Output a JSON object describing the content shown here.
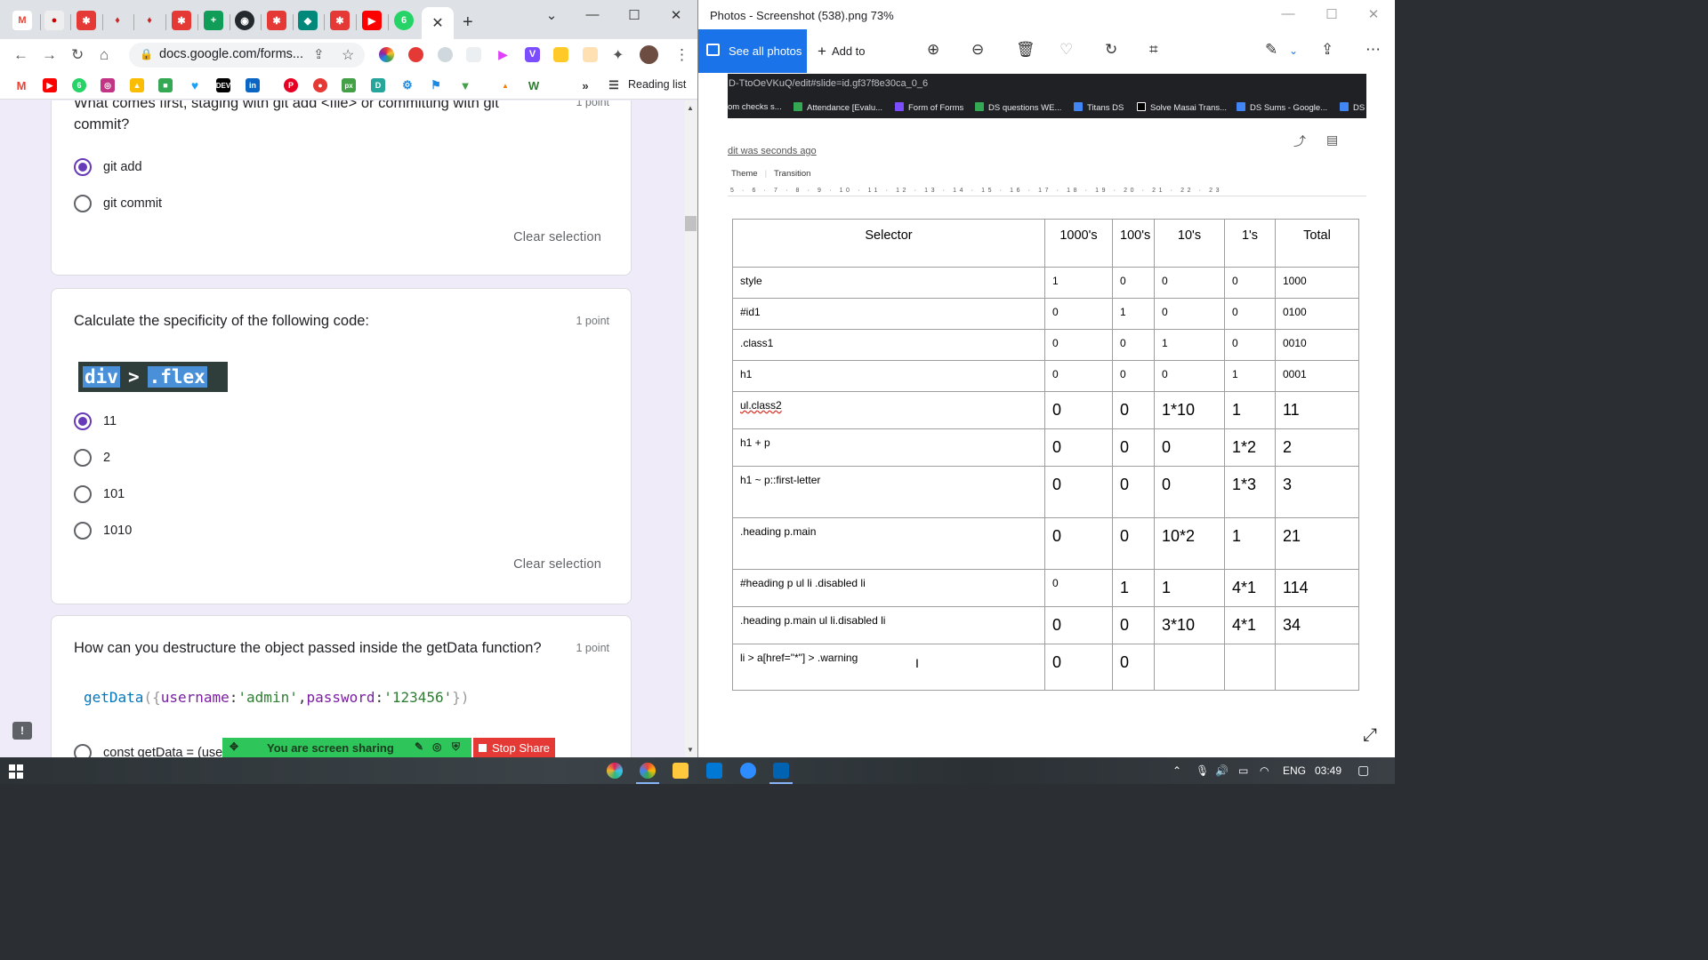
{
  "chrome": {
    "url": "docs.google.com/forms...",
    "reading_list": "Reading list",
    "tab_close": "✕",
    "new_tab": "+"
  },
  "form": {
    "q1": {
      "title_line1": "What comes first, staging with git add <file> or committing with git",
      "title_line2": "commit?",
      "points": "1 point",
      "options": [
        "git add",
        "git commit"
      ],
      "selected": "git add",
      "clear": "Clear selection"
    },
    "q2": {
      "title": "Calculate the specificity of the following code:",
      "points": "1 point",
      "code": {
        "part1": "div",
        "op": ">",
        "part2": ".flex"
      },
      "options": [
        "11",
        "2",
        "101",
        "1010"
      ],
      "selected": "11",
      "clear": "Clear selection"
    },
    "q3": {
      "title": "How can you destructure the object passed inside the getData function?",
      "points": "1 point",
      "code": {
        "fn": "getData",
        "open": "({",
        "k1": "username",
        "v1": "'admin'",
        "k2": "password",
        "v2": "'123456'",
        "close": "})"
      },
      "option_partial": "const getData = (use"
    },
    "feedback_icon": "!",
    "share_text": "You are screen sharing",
    "stop_share": "Stop Share"
  },
  "photos": {
    "title": "Photos - Screenshot (538).png   73%",
    "see_all": "See all photos",
    "add_to": "Add to",
    "screenshot": {
      "url": "D-TtoOeVKuQ/edit#slide=id.gf37f8e30ca_0_6",
      "bookmarks": [
        "om checks s...",
        "Attendance [Evalu...",
        "Form of Forms",
        "DS questions WE...",
        "Titans DS",
        "Solve Masai Trans...",
        "DS Sums - Google...",
        "DS"
      ],
      "saved": "dit was seconds ago",
      "theme": "Theme",
      "transition": "Transition",
      "ruler": "5 · 6 · 7 · 8 · 9 · 10 · 11 · 12 · 13 · 14 · 15 · 16 · 17 · 18 · 19 · 20 · 21 · 22 · 23"
    },
    "table": {
      "headers": [
        "Selector",
        "1000's",
        "100's",
        "10's",
        "1's",
        "Total"
      ],
      "rows": [
        [
          "style",
          "1",
          "0",
          "0",
          "0",
          "1000"
        ],
        [
          "#id1",
          "0",
          "1",
          "0",
          "0",
          "0100"
        ],
        [
          ".class1",
          "0",
          "0",
          "1",
          "0",
          "0010"
        ],
        [
          "h1",
          "0",
          "0",
          "0",
          "1",
          "0001"
        ],
        [
          "ul.class2",
          "0",
          "0",
          "1*10",
          "1",
          "11"
        ],
        [
          "h1 + p",
          "0",
          "0",
          "0",
          "1*2",
          "2"
        ],
        [
          "h1 ~ p::first-letter",
          "0",
          "0",
          "0",
          "1*3",
          "3"
        ],
        [
          ".heading p.main",
          "0",
          "0",
          "10*2",
          "1",
          "21"
        ],
        [
          "#heading p ul li .disabled li",
          "0",
          "1",
          "1",
          "4*1",
          "114"
        ],
        [
          ".heading p.main ul li.disabled li",
          "0",
          "0",
          "3*10",
          "4*1",
          "34"
        ],
        [
          "li > a[href=\"*\"] > .warning",
          "0",
          "0",
          "",
          "",
          ""
        ]
      ]
    }
  },
  "taskbar": {
    "lang": "ENG",
    "time": "03:49"
  }
}
